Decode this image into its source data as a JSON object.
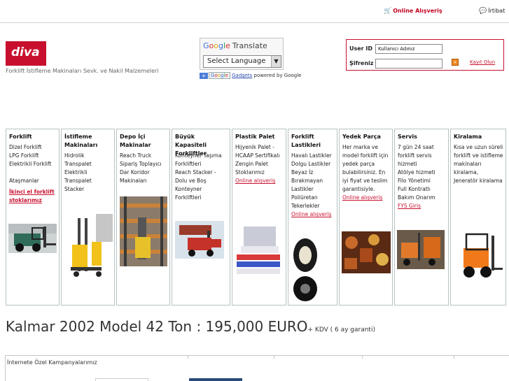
{
  "header": {
    "shop_label": "Online Alışveriş",
    "contact_label": "İrtibat"
  },
  "brand": {
    "logo_text": "diva",
    "tagline": "Forklift İstifleme Makinaları Sevk. ve Nakil Malzemeleri"
  },
  "translate": {
    "title": "Translate",
    "select_label": "Select Language",
    "gadgets_link": "Gadgets",
    "powered_by": "powered by Google"
  },
  "login": {
    "user_label": "User ID",
    "user_value": "Kullanıcı Adınız",
    "password_label": "Şifreniz",
    "go_label": "»",
    "register_label": "Kayıt Olun"
  },
  "categories": [
    {
      "title": "Forklift",
      "items": [
        "Dizel Forklift",
        "LPG Forklift",
        "Elektrikli Forklift",
        "",
        "Ataşmanlar"
      ],
      "link": "İkinci el forklift stoklarımız"
    },
    {
      "title": "İstifleme Makinaları",
      "items": [
        "Hidrolik Transpalet",
        "Elektrikli Transpalet",
        "Stacker"
      ],
      "link": ""
    },
    {
      "title": "Depo İçi Makinalar",
      "items": [
        "Reach Truck",
        "Sipariş Toplayıcı",
        "Dar Koridor Makinaları"
      ],
      "link": ""
    },
    {
      "title": "Büyük Kapasiteli Forkliftler",
      "items": [
        "Konteyner Taşıma Forkliftleri",
        "Reach Stacker - Dolu ve Boş Konteyner Forkliftleri"
      ],
      "link": ""
    },
    {
      "title": "Plastik Palet",
      "items": [
        "Hijyenik Palet - HCAAP Sertifikalı Zengin Palet Stoklarımız"
      ],
      "link": "Online alışveriş"
    },
    {
      "title": "Forklift Lastikleri",
      "items": [
        "Havalı Lastikler Dolgu Lastikler Beyaz İz Bırakmayan Lastikler Poliüretan Tekerlekler"
      ],
      "link": "Online alışveriş"
    },
    {
      "title": "Yedek Parça",
      "items": [
        "Her marka ve model forklift için yedek parça bulabilirsiniz. En iyi fiyat ve teslim garantisiyle."
      ],
      "link": "Online alışveriş"
    },
    {
      "title": "Servis",
      "items": [
        "7 gün 24 saat forklift servis hizmeti",
        "Atölye hizmeti",
        "Filo Yönetimi",
        "Full Kontratlı Bakım Onarım"
      ],
      "link": "FYS Giriş"
    },
    {
      "title": "Kiralama",
      "items": [
        "Kısa ve uzun süreli forklift ve istifleme makinaları kiralama, Jeneratör kiralama"
      ],
      "link": ""
    }
  ],
  "headline": {
    "main": "Kalmar 2002 Model 42 Ton : 195,000 EURO",
    "suffix": "+ KDV   ( 6 ay garanti)"
  },
  "campaign": {
    "title": "İnternete Özel Kampanyalarımız"
  },
  "colors": {
    "brand_red": "#c8102e",
    "panel_border": "#b7c3c3"
  }
}
